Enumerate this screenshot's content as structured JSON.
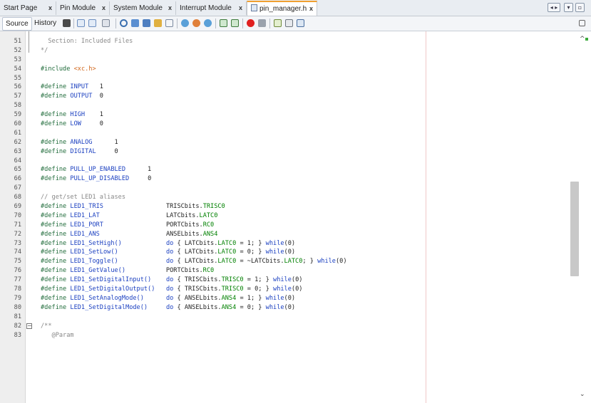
{
  "tabs": [
    {
      "label": "Start Page",
      "active": false
    },
    {
      "label": "Pin Module",
      "active": false
    },
    {
      "label": "System Module",
      "active": false
    },
    {
      "label": "Interrupt Module",
      "active": false
    },
    {
      "label": "pin_manager.h",
      "active": true
    }
  ],
  "toolbar": {
    "source_label": "Source",
    "history_label": "History"
  },
  "colors": {
    "preprocessor": "#2e7d32",
    "keyword": "#1a3fc0",
    "comment": "#888888",
    "include_file": "#d2691e",
    "active_tab_accent": "#f0a030"
  },
  "editor": {
    "lines": [
      {
        "n": "51",
        "text": "  Section: Included Files"
      },
      {
        "n": "52",
        "text": "*/"
      },
      {
        "n": "53",
        "text": ""
      },
      {
        "n": "54",
        "text": "#include <xc.h>"
      },
      {
        "n": "55",
        "text": ""
      },
      {
        "n": "56",
        "text": "#define INPUT   1"
      },
      {
        "n": "57",
        "text": "#define OUTPUT  0"
      },
      {
        "n": "58",
        "text": ""
      },
      {
        "n": "59",
        "text": "#define HIGH    1"
      },
      {
        "n": "60",
        "text": "#define LOW     0"
      },
      {
        "n": "61",
        "text": ""
      },
      {
        "n": "62",
        "text": "#define ANALOG      1"
      },
      {
        "n": "63",
        "text": "#define DIGITAL     0"
      },
      {
        "n": "64",
        "text": ""
      },
      {
        "n": "65",
        "text": "#define PULL_UP_ENABLED      1"
      },
      {
        "n": "66",
        "text": "#define PULL_UP_DISABLED     0"
      },
      {
        "n": "67",
        "text": ""
      },
      {
        "n": "68",
        "text": "// get/set LED1 aliases"
      },
      {
        "n": "69",
        "text": "#define LED1_TRIS                 TRISCbits.TRISC0"
      },
      {
        "n": "70",
        "text": "#define LED1_LAT                  LATCbits.LATC0"
      },
      {
        "n": "71",
        "text": "#define LED1_PORT                 PORTCbits.RC0"
      },
      {
        "n": "72",
        "text": "#define LED1_ANS                  ANSELbits.ANS4"
      },
      {
        "n": "73",
        "text": "#define LED1_SetHigh()            do { LATCbits.LATC0 = 1; } while(0)"
      },
      {
        "n": "74",
        "text": "#define LED1_SetLow()             do { LATCbits.LATC0 = 0; } while(0)"
      },
      {
        "n": "75",
        "text": "#define LED1_Toggle()             do { LATCbits.LATC0 = ~LATCbits.LATC0; } while(0)"
      },
      {
        "n": "76",
        "text": "#define LED1_GetValue()           PORTCbits.RC0"
      },
      {
        "n": "77",
        "text": "#define LED1_SetDigitalInput()    do { TRISCbits.TRISC0 = 1; } while(0)"
      },
      {
        "n": "78",
        "text": "#define LED1_SetDigitalOutput()   do { TRISCbits.TRISC0 = 0; } while(0)"
      },
      {
        "n": "79",
        "text": "#define LED1_SetAnalogMode()      do { ANSELbits.ANS4 = 1; } while(0)"
      },
      {
        "n": "80",
        "text": "#define LED1_SetDigitalMode()     do { ANSELbits.ANS4 = 0; } while(0)"
      },
      {
        "n": "81",
        "text": ""
      },
      {
        "n": "82",
        "text": "/**"
      },
      {
        "n": "83",
        "text": "   @Param"
      }
    ]
  }
}
